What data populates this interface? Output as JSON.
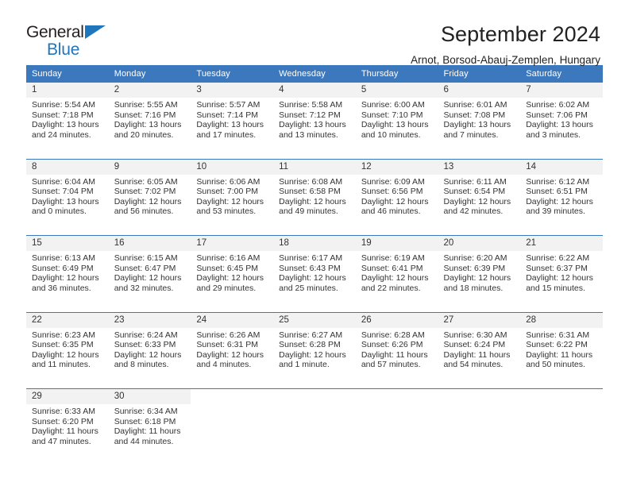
{
  "brand": {
    "name_part1": "General",
    "name_part2": "Blue",
    "triangle_icon": "logo-triangle-icon",
    "accent_color": "#1f76bc"
  },
  "header": {
    "title": "September 2024",
    "location": "Arnot, Borsod-Abauj-Zemplen, Hungary"
  },
  "theme": {
    "header_blue": "#3c78be",
    "daynum_background": "#f2f2f2",
    "text_color": "#333333"
  },
  "calendar": {
    "weekday_headers": [
      "Sunday",
      "Monday",
      "Tuesday",
      "Wednesday",
      "Thursday",
      "Friday",
      "Saturday"
    ],
    "weeks": [
      [
        {
          "day": "1",
          "sunrise": "Sunrise: 5:54 AM",
          "sunset": "Sunset: 7:18 PM",
          "daylight1": "Daylight: 13 hours",
          "daylight2": "and 24 minutes."
        },
        {
          "day": "2",
          "sunrise": "Sunrise: 5:55 AM",
          "sunset": "Sunset: 7:16 PM",
          "daylight1": "Daylight: 13 hours",
          "daylight2": "and 20 minutes."
        },
        {
          "day": "3",
          "sunrise": "Sunrise: 5:57 AM",
          "sunset": "Sunset: 7:14 PM",
          "daylight1": "Daylight: 13 hours",
          "daylight2": "and 17 minutes."
        },
        {
          "day": "4",
          "sunrise": "Sunrise: 5:58 AM",
          "sunset": "Sunset: 7:12 PM",
          "daylight1": "Daylight: 13 hours",
          "daylight2": "and 13 minutes."
        },
        {
          "day": "5",
          "sunrise": "Sunrise: 6:00 AM",
          "sunset": "Sunset: 7:10 PM",
          "daylight1": "Daylight: 13 hours",
          "daylight2": "and 10 minutes."
        },
        {
          "day": "6",
          "sunrise": "Sunrise: 6:01 AM",
          "sunset": "Sunset: 7:08 PM",
          "daylight1": "Daylight: 13 hours",
          "daylight2": "and 7 minutes."
        },
        {
          "day": "7",
          "sunrise": "Sunrise: 6:02 AM",
          "sunset": "Sunset: 7:06 PM",
          "daylight1": "Daylight: 13 hours",
          "daylight2": "and 3 minutes."
        }
      ],
      [
        {
          "day": "8",
          "sunrise": "Sunrise: 6:04 AM",
          "sunset": "Sunset: 7:04 PM",
          "daylight1": "Daylight: 13 hours",
          "daylight2": "and 0 minutes."
        },
        {
          "day": "9",
          "sunrise": "Sunrise: 6:05 AM",
          "sunset": "Sunset: 7:02 PM",
          "daylight1": "Daylight: 12 hours",
          "daylight2": "and 56 minutes."
        },
        {
          "day": "10",
          "sunrise": "Sunrise: 6:06 AM",
          "sunset": "Sunset: 7:00 PM",
          "daylight1": "Daylight: 12 hours",
          "daylight2": "and 53 minutes."
        },
        {
          "day": "11",
          "sunrise": "Sunrise: 6:08 AM",
          "sunset": "Sunset: 6:58 PM",
          "daylight1": "Daylight: 12 hours",
          "daylight2": "and 49 minutes."
        },
        {
          "day": "12",
          "sunrise": "Sunrise: 6:09 AM",
          "sunset": "Sunset: 6:56 PM",
          "daylight1": "Daylight: 12 hours",
          "daylight2": "and 46 minutes."
        },
        {
          "day": "13",
          "sunrise": "Sunrise: 6:11 AM",
          "sunset": "Sunset: 6:54 PM",
          "daylight1": "Daylight: 12 hours",
          "daylight2": "and 42 minutes."
        },
        {
          "day": "14",
          "sunrise": "Sunrise: 6:12 AM",
          "sunset": "Sunset: 6:51 PM",
          "daylight1": "Daylight: 12 hours",
          "daylight2": "and 39 minutes."
        }
      ],
      [
        {
          "day": "15",
          "sunrise": "Sunrise: 6:13 AM",
          "sunset": "Sunset: 6:49 PM",
          "daylight1": "Daylight: 12 hours",
          "daylight2": "and 36 minutes."
        },
        {
          "day": "16",
          "sunrise": "Sunrise: 6:15 AM",
          "sunset": "Sunset: 6:47 PM",
          "daylight1": "Daylight: 12 hours",
          "daylight2": "and 32 minutes."
        },
        {
          "day": "17",
          "sunrise": "Sunrise: 6:16 AM",
          "sunset": "Sunset: 6:45 PM",
          "daylight1": "Daylight: 12 hours",
          "daylight2": "and 29 minutes."
        },
        {
          "day": "18",
          "sunrise": "Sunrise: 6:17 AM",
          "sunset": "Sunset: 6:43 PM",
          "daylight1": "Daylight: 12 hours",
          "daylight2": "and 25 minutes."
        },
        {
          "day": "19",
          "sunrise": "Sunrise: 6:19 AM",
          "sunset": "Sunset: 6:41 PM",
          "daylight1": "Daylight: 12 hours",
          "daylight2": "and 22 minutes."
        },
        {
          "day": "20",
          "sunrise": "Sunrise: 6:20 AM",
          "sunset": "Sunset: 6:39 PM",
          "daylight1": "Daylight: 12 hours",
          "daylight2": "and 18 minutes."
        },
        {
          "day": "21",
          "sunrise": "Sunrise: 6:22 AM",
          "sunset": "Sunset: 6:37 PM",
          "daylight1": "Daylight: 12 hours",
          "daylight2": "and 15 minutes."
        }
      ],
      [
        {
          "day": "22",
          "sunrise": "Sunrise: 6:23 AM",
          "sunset": "Sunset: 6:35 PM",
          "daylight1": "Daylight: 12 hours",
          "daylight2": "and 11 minutes."
        },
        {
          "day": "23",
          "sunrise": "Sunrise: 6:24 AM",
          "sunset": "Sunset: 6:33 PM",
          "daylight1": "Daylight: 12 hours",
          "daylight2": "and 8 minutes."
        },
        {
          "day": "24",
          "sunrise": "Sunrise: 6:26 AM",
          "sunset": "Sunset: 6:31 PM",
          "daylight1": "Daylight: 12 hours",
          "daylight2": "and 4 minutes."
        },
        {
          "day": "25",
          "sunrise": "Sunrise: 6:27 AM",
          "sunset": "Sunset: 6:28 PM",
          "daylight1": "Daylight: 12 hours",
          "daylight2": "and 1 minute."
        },
        {
          "day": "26",
          "sunrise": "Sunrise: 6:28 AM",
          "sunset": "Sunset: 6:26 PM",
          "daylight1": "Daylight: 11 hours",
          "daylight2": "and 57 minutes."
        },
        {
          "day": "27",
          "sunrise": "Sunrise: 6:30 AM",
          "sunset": "Sunset: 6:24 PM",
          "daylight1": "Daylight: 11 hours",
          "daylight2": "and 54 minutes."
        },
        {
          "day": "28",
          "sunrise": "Sunrise: 6:31 AM",
          "sunset": "Sunset: 6:22 PM",
          "daylight1": "Daylight: 11 hours",
          "daylight2": "and 50 minutes."
        }
      ],
      [
        {
          "day": "29",
          "sunrise": "Sunrise: 6:33 AM",
          "sunset": "Sunset: 6:20 PM",
          "daylight1": "Daylight: 11 hours",
          "daylight2": "and 47 minutes."
        },
        {
          "day": "30",
          "sunrise": "Sunrise: 6:34 AM",
          "sunset": "Sunset: 6:18 PM",
          "daylight1": "Daylight: 11 hours",
          "daylight2": "and 44 minutes."
        },
        {
          "day": "",
          "sunrise": "",
          "sunset": "",
          "daylight1": "",
          "daylight2": ""
        },
        {
          "day": "",
          "sunrise": "",
          "sunset": "",
          "daylight1": "",
          "daylight2": ""
        },
        {
          "day": "",
          "sunrise": "",
          "sunset": "",
          "daylight1": "",
          "daylight2": ""
        },
        {
          "day": "",
          "sunrise": "",
          "sunset": "",
          "daylight1": "",
          "daylight2": ""
        },
        {
          "day": "",
          "sunrise": "",
          "sunset": "",
          "daylight1": "",
          "daylight2": ""
        }
      ]
    ]
  }
}
